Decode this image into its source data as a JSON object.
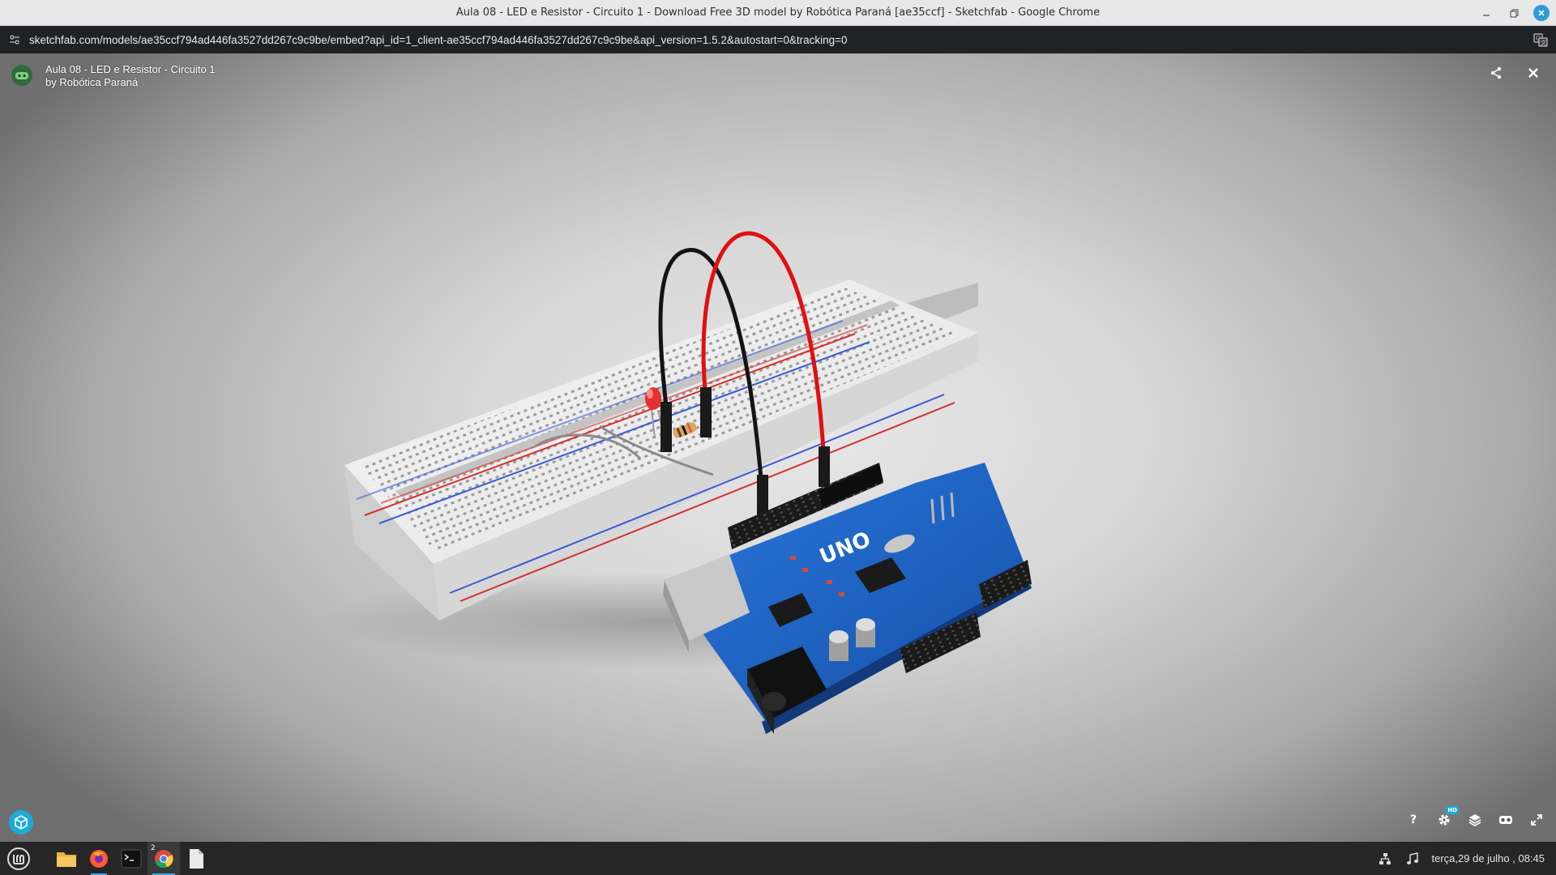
{
  "window": {
    "title": "Aula 08 - LED e Resistor - Circuito 1 - Download Free 3D model by Robótica Paraná [ae35ccf] - Sketchfab - Google Chrome"
  },
  "address_bar": {
    "url": "sketchfab.com/models/ae35ccf794ad446fa3527dd267c9c9be/embed?api_id=1_client-ae35ccf794ad446fa3527dd267c9c9be&api_version=1.5.2&autostart=0&tracking=0"
  },
  "viewer": {
    "model_title": "Aula 08 - LED e Resistor - Circuito 1",
    "author_line": "by Robótica Paraná",
    "hd_badge": "HD",
    "help_label": "?"
  },
  "taskbar": {
    "clock": "terça,29 de julho , 08:45",
    "chrome_badge": "2"
  },
  "colors": {
    "accent": "#1caad9",
    "board_blue": "#1d5fc4",
    "breadboard": "#efefef",
    "wire_red": "#e01515",
    "wire_black": "#111111"
  }
}
